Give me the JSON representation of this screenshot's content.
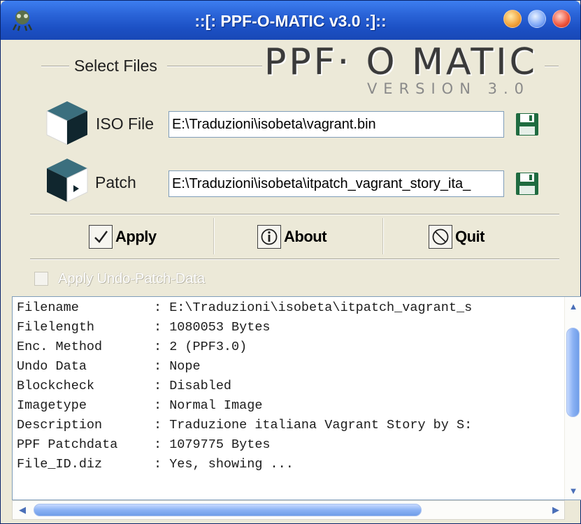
{
  "window": {
    "title": "::[: PPF-O-MATIC v3.0 :]::",
    "colors": {
      "titlebar": "#2a64d8",
      "face": "#ece9d8",
      "minimize": "#f2a23a",
      "maximize": "#7fa8f6",
      "close": "#f0553c"
    }
  },
  "group": {
    "label": "Select Files"
  },
  "logo": {
    "main": "PPF· O MATIC",
    "sub": "VERSION 3.0"
  },
  "fields": {
    "iso": {
      "label": "ISO File",
      "value": "E:\\Traduzioni\\isobeta\\vagrant.bin",
      "icon": "iso-box-icon",
      "save_icon": "floppy-disk-icon"
    },
    "patch": {
      "label": "Patch",
      "value": "E:\\Traduzioni\\isobeta\\itpatch_vagrant_story_ita_",
      "icon": "patch-box-icon",
      "save_icon": "floppy-disk-icon"
    }
  },
  "buttons": {
    "apply": {
      "label": "Apply",
      "icon": "checkmark-icon"
    },
    "about": {
      "label": "About",
      "icon": "info-icon"
    },
    "quit": {
      "label": "Quit",
      "icon": "no-symbol-icon"
    }
  },
  "options": {
    "undo_label": "Apply Undo-Patch-Data",
    "undo_checked": false,
    "undo_enabled": false
  },
  "info": {
    "rows": [
      {
        "key": "Filename",
        "value": ": E:\\Traduzioni\\isobeta\\itpatch_vagrant_s"
      },
      {
        "key": "Filelength",
        "value": ": 1080053 Bytes"
      },
      {
        "key": "Enc. Method",
        "value": ": 2 (PPF3.0)"
      },
      {
        "key": "Undo Data",
        "value": ": Nope"
      },
      {
        "key": "Blockcheck",
        "value": ": Disabled"
      },
      {
        "key": "Imagetype",
        "value": ": Normal Image"
      },
      {
        "key": "Description",
        "value": ": Traduzione italiana Vagrant Story by S:"
      },
      {
        "key": "PPF Patchdata",
        "value": ": 1079775 Bytes"
      },
      {
        "key": "File_ID.diz",
        "value": ": Yes, showing ..."
      }
    ]
  }
}
